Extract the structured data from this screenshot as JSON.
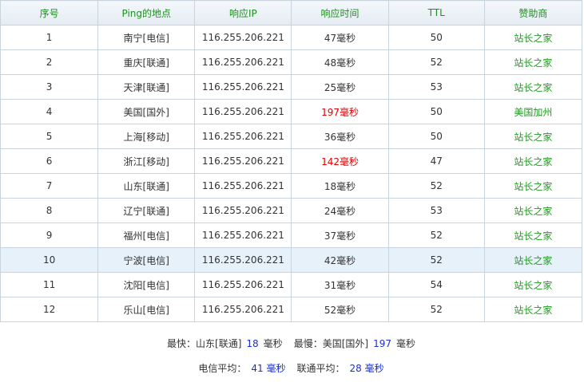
{
  "columns": [
    "序号",
    "Ping的地点",
    "响应IP",
    "响应时间",
    "TTL",
    "赞助商"
  ],
  "highlight_color": "#e7f1fa",
  "rows": [
    {
      "no": "1",
      "location": "南宁[电信]",
      "ip": "116.255.206.221",
      "time": "47毫秒",
      "ttl": "50",
      "sponsor": "站长之家",
      "slow": false,
      "highlight": false
    },
    {
      "no": "2",
      "location": "重庆[联通]",
      "ip": "116.255.206.221",
      "time": "48毫秒",
      "ttl": "52",
      "sponsor": "站长之家",
      "slow": false,
      "highlight": false
    },
    {
      "no": "3",
      "location": "天津[联通]",
      "ip": "116.255.206.221",
      "time": "25毫秒",
      "ttl": "53",
      "sponsor": "站长之家",
      "slow": false,
      "highlight": false
    },
    {
      "no": "4",
      "location": "美国[国外]",
      "ip": "116.255.206.221",
      "time": "197毫秒",
      "ttl": "50",
      "sponsor": "美国加州",
      "slow": true,
      "highlight": false
    },
    {
      "no": "5",
      "location": "上海[移动]",
      "ip": "116.255.206.221",
      "time": "36毫秒",
      "ttl": "50",
      "sponsor": "站长之家",
      "slow": false,
      "highlight": false
    },
    {
      "no": "6",
      "location": "浙江[移动]",
      "ip": "116.255.206.221",
      "time": "142毫秒",
      "ttl": "47",
      "sponsor": "站长之家",
      "slow": true,
      "highlight": false
    },
    {
      "no": "7",
      "location": "山东[联通]",
      "ip": "116.255.206.221",
      "time": "18毫秒",
      "ttl": "52",
      "sponsor": "站长之家",
      "slow": false,
      "highlight": false
    },
    {
      "no": "8",
      "location": "辽宁[联通]",
      "ip": "116.255.206.221",
      "time": "24毫秒",
      "ttl": "53",
      "sponsor": "站长之家",
      "slow": false,
      "highlight": false
    },
    {
      "no": "9",
      "location": "福州[电信]",
      "ip": "116.255.206.221",
      "time": "37毫秒",
      "ttl": "52",
      "sponsor": "站长之家",
      "slow": false,
      "highlight": false
    },
    {
      "no": "10",
      "location": "宁波[电信]",
      "ip": "116.255.206.221",
      "time": "42毫秒",
      "ttl": "52",
      "sponsor": "站长之家",
      "slow": false,
      "highlight": true
    },
    {
      "no": "11",
      "location": "沈阳[电信]",
      "ip": "116.255.206.221",
      "time": "31毫秒",
      "ttl": "54",
      "sponsor": "站长之家",
      "slow": false,
      "highlight": false
    },
    {
      "no": "12",
      "location": "乐山[电信]",
      "ip": "116.255.206.221",
      "time": "52毫秒",
      "ttl": "52",
      "sponsor": "站长之家",
      "slow": false,
      "highlight": false
    }
  ],
  "summary": {
    "fastest_label": "最快：山东[联通]",
    "fastest_value": "18",
    "fastest_unit": "毫秒",
    "slowest_label": "最慢：美国[国外]",
    "slowest_value": "197",
    "slowest_unit": "毫秒",
    "telecom_label": "电信平均：",
    "telecom_value": "41 毫秒",
    "unicom_label": "联通平均：",
    "unicom_value": "28 毫秒"
  }
}
